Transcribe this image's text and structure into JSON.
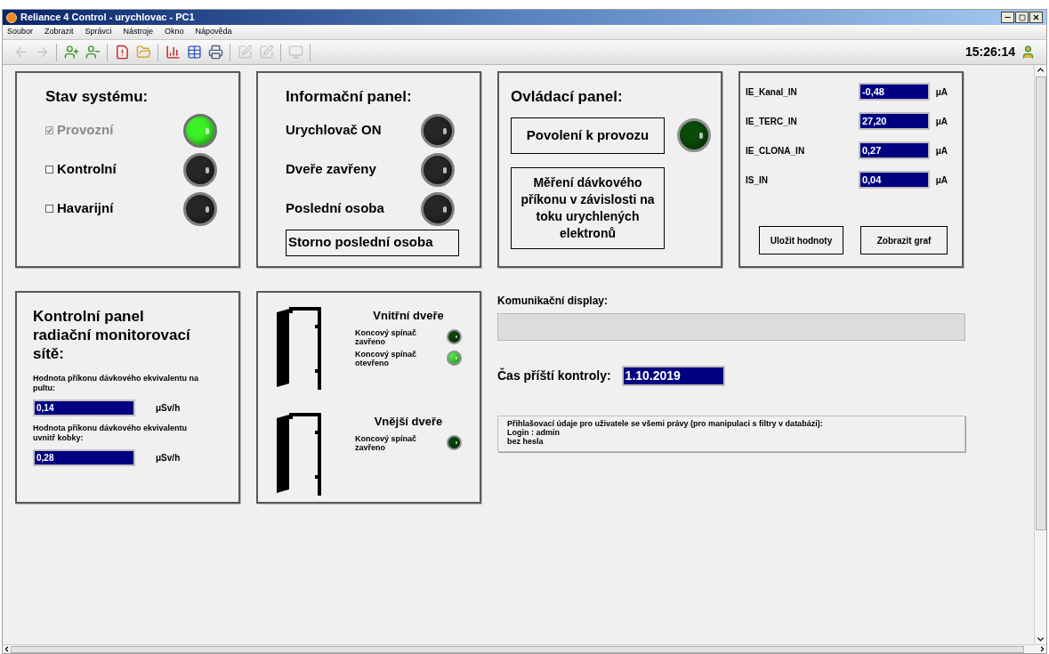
{
  "window": {
    "title": "Reliance 4 Control - urychlovac - PC1"
  },
  "menu": [
    "Soubor",
    "Zobrazit",
    "Správci",
    "Nástroje",
    "Okno",
    "Nápověda"
  ],
  "toolbar": [
    {
      "kind": "back",
      "disabled": true
    },
    {
      "kind": "forward",
      "disabled": true
    },
    {
      "kind": "user-add",
      "disabled": false
    },
    {
      "kind": "user-remove",
      "disabled": false
    },
    {
      "kind": "document-alert",
      "disabled": false
    },
    {
      "kind": "folder-alert",
      "disabled": false
    },
    {
      "kind": "chart",
      "disabled": false
    },
    {
      "kind": "table",
      "disabled": false
    },
    {
      "kind": "printer",
      "disabled": false
    },
    {
      "kind": "edit",
      "disabled": true
    },
    {
      "kind": "edit",
      "disabled": true
    },
    {
      "kind": "monitor",
      "disabled": true
    }
  ],
  "clock": "15:26:14",
  "system_status": {
    "title": "Stav systému:",
    "items": [
      {
        "label": "Provozní",
        "checked": true,
        "disabled": true,
        "lamp": {
          "kind": "neutral",
          "on": true
        }
      },
      {
        "label": "Kontrolní",
        "checked": false,
        "disabled": false,
        "lamp": {
          "kind": "neutral",
          "on": false
        }
      },
      {
        "label": "Havarijní",
        "checked": false,
        "disabled": false,
        "lamp": {
          "kind": "neutral",
          "on": false
        }
      }
    ]
  },
  "info_panel": {
    "title": "Informační panel:",
    "items": [
      {
        "label": "Urychlovač ON",
        "lamp": {
          "kind": "neutral",
          "on": false
        }
      },
      {
        "label": "Dveře zavřeny",
        "lamp": {
          "kind": "neutral",
          "on": false
        }
      },
      {
        "label": "Poslední osoba",
        "lamp": {
          "kind": "neutral",
          "on": false
        }
      }
    ],
    "button": "Storno poslední osoba"
  },
  "control_panel": {
    "title": "Ovládací panel:",
    "enable_button": "Povolení k provozu",
    "enable_lamp": {
      "kind": "green",
      "on": false
    },
    "measure_button": "Měření dávkového příkonu v závislosti na toku urychlených elektronů"
  },
  "currents": {
    "rows": [
      {
        "label": "IE_Kanal_IN",
        "value": "-0,48",
        "unit": "μA"
      },
      {
        "label": "IE_TERC_IN",
        "value": "27,20",
        "unit": "μA"
      },
      {
        "label": "IE_CLONA_IN",
        "value": "0,27",
        "unit": "μA"
      },
      {
        "label": "IS_IN",
        "value": "0,04",
        "unit": "μA"
      }
    ],
    "buttons": [
      "Uložit hodnoty",
      "Zobrazit graf"
    ]
  },
  "radiation_panel": {
    "title": "Kontrolní panel radiační monitorovací sítě:",
    "readings": [
      {
        "label": "Hodnota příkonu dávkového ekvivalentu na pultu:",
        "value": "0,14",
        "unit": "μSv/h"
      },
      {
        "label": "Hodnota příkonu dávkového ekvivalentu uvnitř kobky:",
        "value": "0,28",
        "unit": "μSv/h"
      }
    ]
  },
  "doors": [
    {
      "title": "Vnitřní dveře",
      "switches": [
        {
          "label": "Koncový spínač zavřeno",
          "lamp": {
            "kind": "green",
            "on": false
          }
        },
        {
          "label": "Koncový spínač otevřeno",
          "lamp": {
            "kind": "green",
            "on": true
          }
        }
      ]
    },
    {
      "title": "Vnější dveře",
      "switches": [
        {
          "label": "Koncový spínač zavřeno",
          "lamp": {
            "kind": "green",
            "on": false
          }
        }
      ]
    }
  ],
  "communication": {
    "label": "Komunikační display:"
  },
  "next_check": {
    "label": "Čas příští kontroly:",
    "value": "1.10.2019"
  },
  "login_note": {
    "lines": [
      "Přihlašovací údaje pro uživatele se všemi právy (pro manipulaci s filtry v databázi):",
      "Login : admin",
      "bez hesla"
    ]
  }
}
